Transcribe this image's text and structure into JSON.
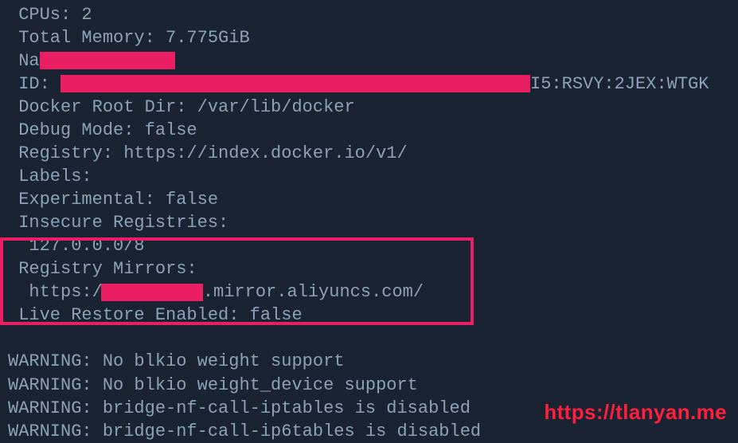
{
  "terminal": {
    "cpus_line": " CPUs: 2",
    "memory_line": " Total Memory: 7.775GiB",
    "name_prefix": " Na",
    "id_prefix": " ID: ",
    "id_suffix": "I5:RSVY:2JEX:WTGK",
    "docker_root": " Docker Root Dir: /var/lib/docker",
    "debug_mode": " Debug Mode: false",
    "registry": " Registry: https://index.docker.io/v1/",
    "labels": " Labels:",
    "experimental": " Experimental: false",
    "insecure_header": " Insecure Registries:",
    "insecure_entry": "  127.0.0.0/8",
    "mirrors_header": " Registry Mirrors:",
    "mirror_prefix": "  https:/",
    "mirror_suffix": ".mirror.aliyuncs.com/",
    "live_restore": " Live Restore Enabled: false",
    "warn1": "WARNING: No blkio weight support",
    "warn2": "WARNING: No blkio weight_device support",
    "warn3": "WARNING: bridge-nf-call-iptables is disabled",
    "warn4": "WARNING: bridge-nf-call-ip6tables is disabled"
  },
  "watermark": "https://tlanyan.me"
}
